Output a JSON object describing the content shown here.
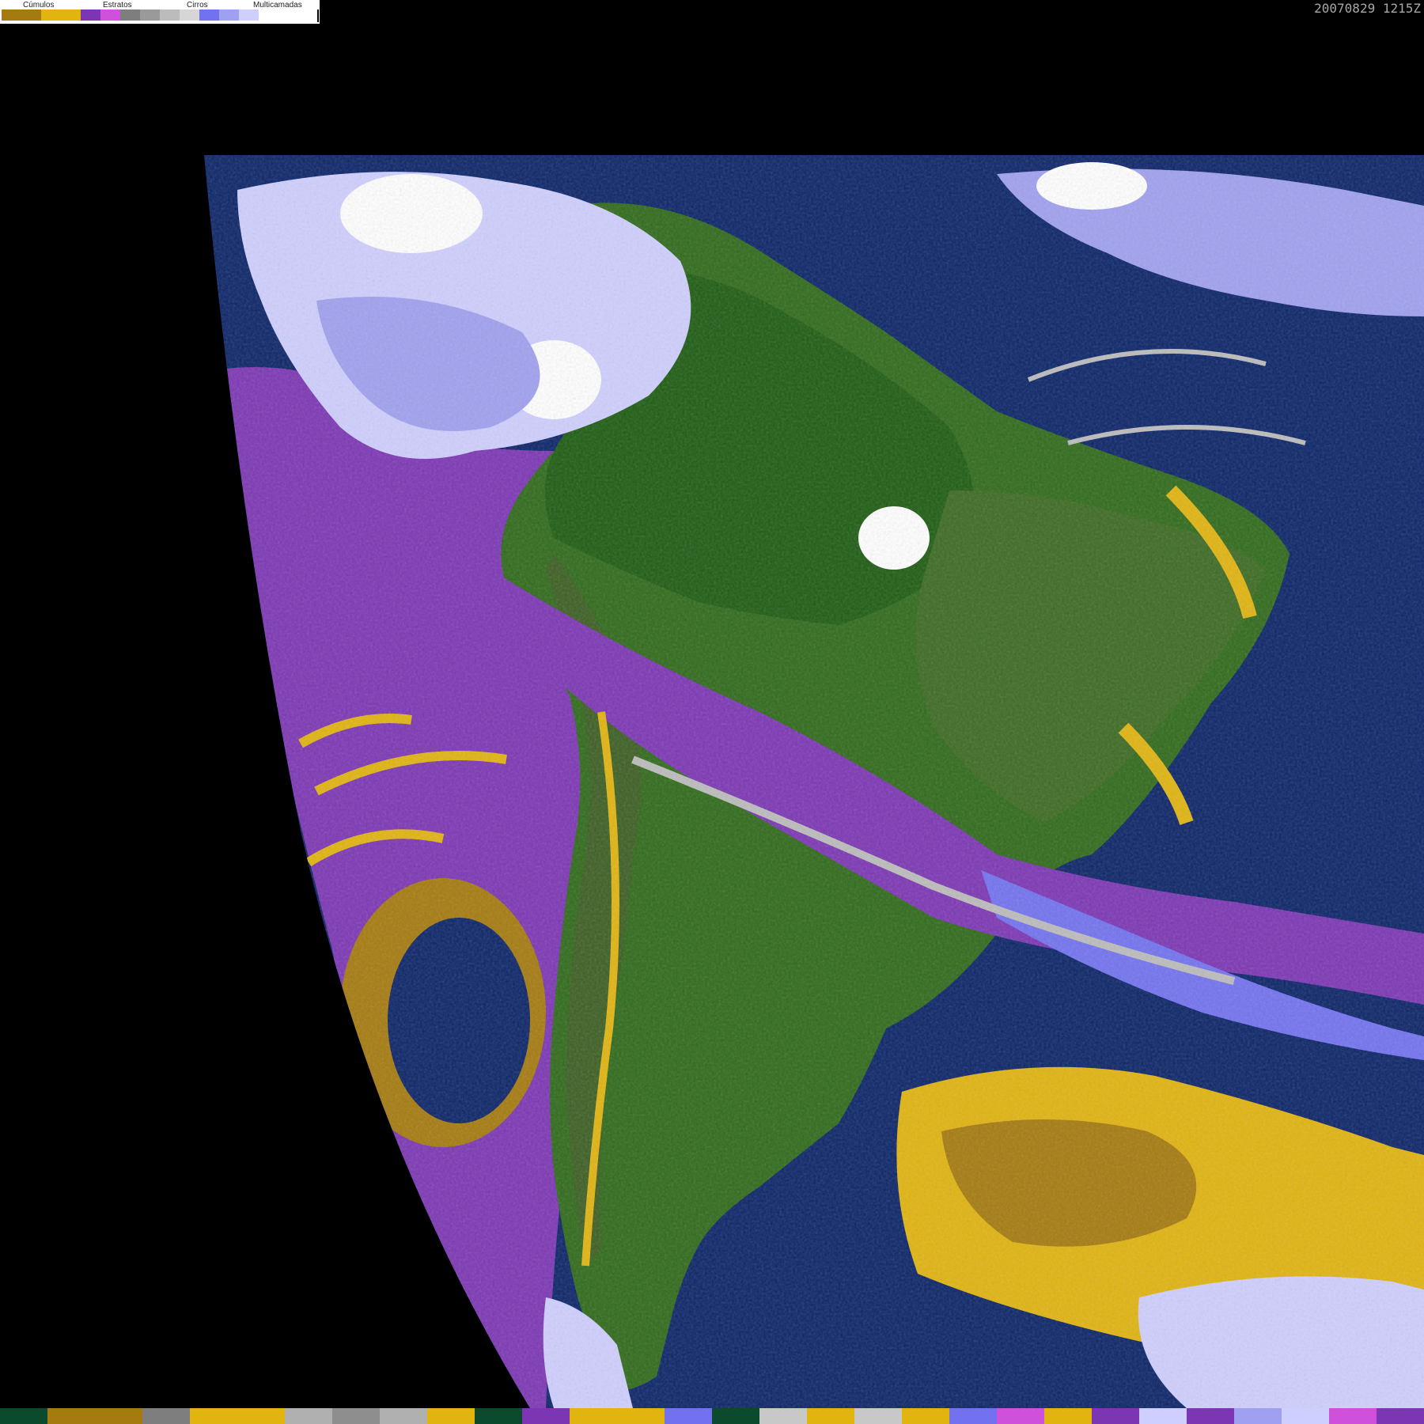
{
  "timestamp": "20070829 1215Z",
  "legend": {
    "groups": [
      {
        "label": "Cúmulos",
        "colors": [
          "#a57a0e",
          "#e1b40f"
        ]
      },
      {
        "label": "Estratos",
        "colors": [
          "#7c36b4",
          "#cf50db"
        ]
      },
      {
        "label": "Cirros",
        "colors": [
          "#7e7e7e",
          "#9a9a9a",
          "#bcbcbc",
          "#d6d6d6"
        ]
      },
      {
        "label": "Multicamadas",
        "colors": [
          "#7272f0",
          "#a0a0f0",
          "#cfcfff",
          "#ffffff"
        ]
      }
    ]
  },
  "colors": {
    "background": "#000000",
    "ocean": "#0b2468",
    "land": "#2f6a1a",
    "forest": "#1d5c12",
    "stratus": "#7c36b4",
    "stratus_light": "#cf50db",
    "cumulus": "#e1b40f",
    "cumulus_dark": "#a57a0e",
    "cirrus": "#bcbcbc",
    "multilayer": "#cfcfff",
    "multilayer_dark": "#7272f0"
  },
  "bottom_strip": [
    "#0b4a2c",
    "#a57a0e",
    "#a57a0e",
    "#7e7e7e",
    "#e1b40f",
    "#e1b40f",
    "#b0b0b0",
    "#8e8e8e",
    "#b0b0b0",
    "#e1b40f",
    "#0b4a2c",
    "#7c36b4",
    "#e1b40f",
    "#e1b40f",
    "#7272f0",
    "#0b4a2c",
    "#c8c8c8",
    "#e1b40f",
    "#c8c8c8",
    "#e1b40f",
    "#7272f0",
    "#cf50db",
    "#e1b40f",
    "#7c36b4",
    "#cfcfff",
    "#7c36b4",
    "#a0a0f0",
    "#cfcfff",
    "#cf50db",
    "#7c36b4"
  ]
}
